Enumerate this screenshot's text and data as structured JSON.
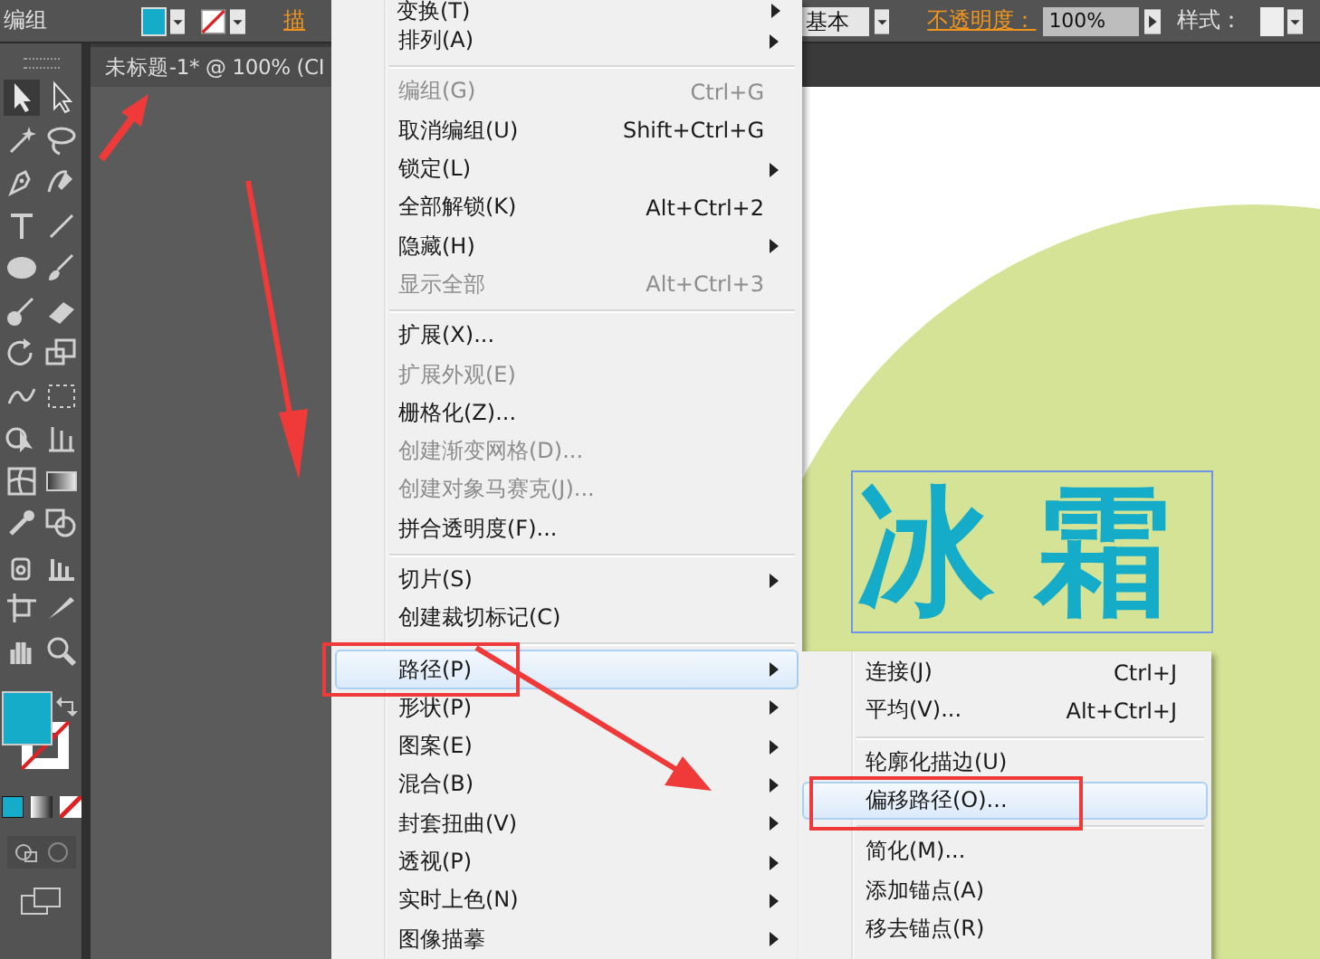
{
  "control_bar": {
    "selection_label": "编组",
    "stroke_label": "描",
    "brush_label": "基本",
    "opacity_label": "不透明度：",
    "opacity_value": "100%",
    "style_label": "样式："
  },
  "document_tab": {
    "title": "未标题-1* @ 100% (CI"
  },
  "canvas": {
    "artwork_text": "冰霜"
  },
  "menu": {
    "items": [
      {
        "kind": "item",
        "label": "变换(T)",
        "submenu": true,
        "disabled": false,
        "selected": false
      },
      {
        "kind": "item",
        "label": "排列(A)",
        "submenu": true,
        "disabled": false,
        "selected": false
      },
      {
        "kind": "separator"
      },
      {
        "kind": "item",
        "label": "编组(G)",
        "shortcut": "Ctrl+G",
        "submenu": false,
        "disabled": true,
        "selected": false
      },
      {
        "kind": "item",
        "label": "取消编组(U)",
        "shortcut": "Shift+Ctrl+G",
        "submenu": false,
        "disabled": false,
        "selected": false
      },
      {
        "kind": "item",
        "label": "锁定(L)",
        "submenu": true,
        "disabled": false,
        "selected": false
      },
      {
        "kind": "item",
        "label": "全部解锁(K)",
        "shortcut": "Alt+Ctrl+2",
        "submenu": false,
        "disabled": false,
        "selected": false
      },
      {
        "kind": "item",
        "label": "隐藏(H)",
        "submenu": true,
        "disabled": false,
        "selected": false
      },
      {
        "kind": "item",
        "label": "显示全部",
        "shortcut": "Alt+Ctrl+3",
        "submenu": false,
        "disabled": true,
        "selected": false
      },
      {
        "kind": "separator"
      },
      {
        "kind": "item",
        "label": "扩展(X)...",
        "submenu": false,
        "disabled": false,
        "selected": false
      },
      {
        "kind": "item",
        "label": "扩展外观(E)",
        "submenu": false,
        "disabled": true,
        "selected": false
      },
      {
        "kind": "item",
        "label": "栅格化(Z)...",
        "submenu": false,
        "disabled": false,
        "selected": false
      },
      {
        "kind": "item",
        "label": "创建渐变网格(D)...",
        "submenu": false,
        "disabled": true,
        "selected": false
      },
      {
        "kind": "item",
        "label": "创建对象马赛克(J)...",
        "submenu": false,
        "disabled": true,
        "selected": false
      },
      {
        "kind": "item",
        "label": "拼合透明度(F)...",
        "submenu": false,
        "disabled": false,
        "selected": false
      },
      {
        "kind": "separator"
      },
      {
        "kind": "item",
        "label": "切片(S)",
        "submenu": true,
        "disabled": false,
        "selected": false
      },
      {
        "kind": "item",
        "label": "创建裁切标记(C)",
        "submenu": false,
        "disabled": false,
        "selected": false
      },
      {
        "kind": "separator"
      },
      {
        "kind": "item",
        "label": "路径(P)",
        "submenu": true,
        "disabled": false,
        "selected": true
      },
      {
        "kind": "item",
        "label": "形状(P)",
        "submenu": true,
        "disabled": false,
        "selected": false
      },
      {
        "kind": "item",
        "label": "图案(E)",
        "submenu": true,
        "disabled": false,
        "selected": false
      },
      {
        "kind": "item",
        "label": "混合(B)",
        "submenu": true,
        "disabled": false,
        "selected": false
      },
      {
        "kind": "item",
        "label": "封套扭曲(V)",
        "submenu": true,
        "disabled": false,
        "selected": false
      },
      {
        "kind": "item",
        "label": "透视(P)",
        "submenu": true,
        "disabled": false,
        "selected": false
      },
      {
        "kind": "item",
        "label": "实时上色(N)",
        "submenu": true,
        "disabled": false,
        "selected": false
      },
      {
        "kind": "item",
        "label": "图像描摹",
        "submenu": true,
        "disabled": false,
        "selected": false
      }
    ]
  },
  "submenu": {
    "items": [
      {
        "kind": "item",
        "label": "连接(J)",
        "shortcut": "Ctrl+J",
        "selected": false
      },
      {
        "kind": "item",
        "label": "平均(V)...",
        "shortcut": "Alt+Ctrl+J",
        "selected": false
      },
      {
        "kind": "separator"
      },
      {
        "kind": "item",
        "label": "轮廓化描边(U)",
        "selected": false
      },
      {
        "kind": "item",
        "label": "偏移路径(O)...",
        "selected": true
      },
      {
        "kind": "separator"
      },
      {
        "kind": "item",
        "label": "简化(M)...",
        "selected": false
      },
      {
        "kind": "item",
        "label": "添加锚点(A)",
        "selected": false
      },
      {
        "kind": "item",
        "label": "移去锚点(R)",
        "selected": false
      }
    ]
  }
}
